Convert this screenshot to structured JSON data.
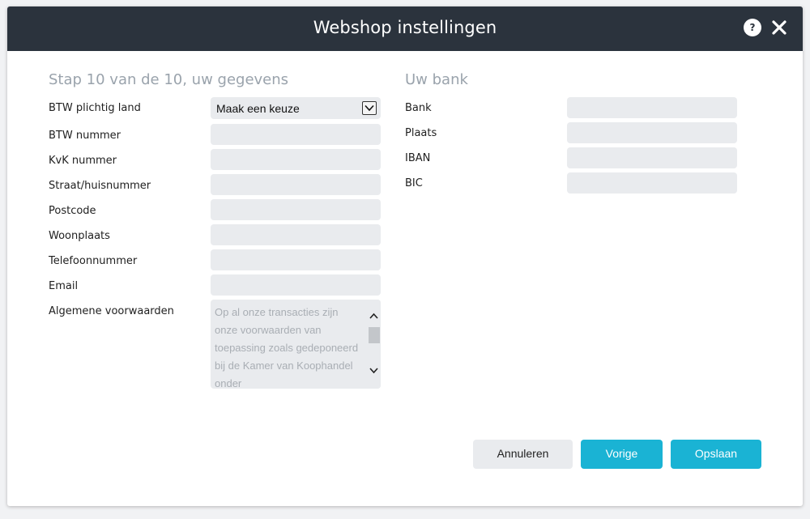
{
  "dialog": {
    "title": "Webshop instellingen",
    "help_label": "?"
  },
  "left": {
    "section_title": "Stap 10 van de 10, uw gegevens",
    "fields": {
      "btw_land": {
        "label": "BTW plichtig land",
        "value": "Maak een keuze"
      },
      "btw_nummer": {
        "label": "BTW nummer",
        "value": ""
      },
      "kvk_nummer": {
        "label": "KvK nummer",
        "value": ""
      },
      "straat": {
        "label": "Straat/huisnummer",
        "value": ""
      },
      "postcode": {
        "label": "Postcode",
        "value": ""
      },
      "woonplaats": {
        "label": "Woonplaats",
        "value": ""
      },
      "telefoon": {
        "label": "Telefoonnummer",
        "value": ""
      },
      "email": {
        "label": "Email",
        "value": ""
      },
      "voorwaarden": {
        "label": "Algemene voorwaarden",
        "placeholder": "Op al onze transacties zijn onze voorwaarden van toepassing zoals gedeponeerd bij de Kamer van Koophandel onder"
      }
    }
  },
  "right": {
    "section_title": "Uw bank",
    "fields": {
      "bank": {
        "label": "Bank",
        "value": ""
      },
      "plaats": {
        "label": "Plaats",
        "value": ""
      },
      "iban": {
        "label": "IBAN",
        "value": ""
      },
      "bic": {
        "label": "BIC",
        "value": ""
      }
    }
  },
  "buttons": {
    "cancel": "Annuleren",
    "previous": "Vorige",
    "save": "Opslaan"
  },
  "colors": {
    "header_bg": "#2b333d",
    "field_bg": "#e9ebee",
    "primary": "#1ab3d4",
    "section_title": "#9aa3ac"
  }
}
